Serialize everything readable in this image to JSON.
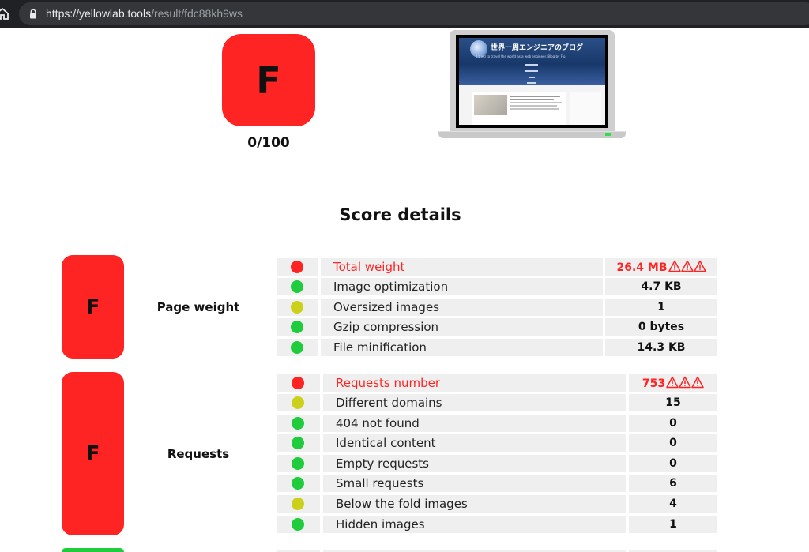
{
  "browser": {
    "url_host": "https://yellowlab.tools",
    "url_path": "/result/fdc88kh9ws"
  },
  "summary": {
    "grade": "F",
    "score": "0/100"
  },
  "screenshot": {
    "site_title": "世界一周エンジニアのブログ",
    "site_subtitle": "I tried to travel the world as a web engineer. Blog by Flo."
  },
  "section_title": "Score details",
  "categories": [
    {
      "grade": "F",
      "label": "Page weight",
      "rules": [
        {
          "status": "red",
          "name": "Total weight",
          "value": "26.4 MB",
          "warnings": 3
        },
        {
          "status": "green",
          "name": "Image optimization",
          "value": "4.7 KB",
          "warnings": 0
        },
        {
          "status": "yellow",
          "name": "Oversized images",
          "value": "1",
          "warnings": 0
        },
        {
          "status": "green",
          "name": "Gzip compression",
          "value": "0 bytes",
          "warnings": 0
        },
        {
          "status": "green",
          "name": "File minification",
          "value": "14.3 KB",
          "warnings": 0
        }
      ]
    },
    {
      "grade": "F",
      "label": "Requests",
      "rules": [
        {
          "status": "red",
          "name": "Requests number",
          "value": "753",
          "warnings": 3
        },
        {
          "status": "yellow",
          "name": "Different domains",
          "value": "15",
          "warnings": 0
        },
        {
          "status": "green",
          "name": "404 not found",
          "value": "0",
          "warnings": 0
        },
        {
          "status": "green",
          "name": "Identical content",
          "value": "0",
          "warnings": 0
        },
        {
          "status": "green",
          "name": "Empty requests",
          "value": "0",
          "warnings": 0
        },
        {
          "status": "green",
          "name": "Small requests",
          "value": "6",
          "warnings": 0
        },
        {
          "status": "yellow",
          "name": "Below the fold images",
          "value": "4",
          "warnings": 0
        },
        {
          "status": "green",
          "name": "Hidden images",
          "value": "1",
          "warnings": 0
        }
      ]
    }
  ],
  "colors": {
    "bad": "#ff2424",
    "good": "#1ecc3c",
    "average": "#cbd11a"
  }
}
